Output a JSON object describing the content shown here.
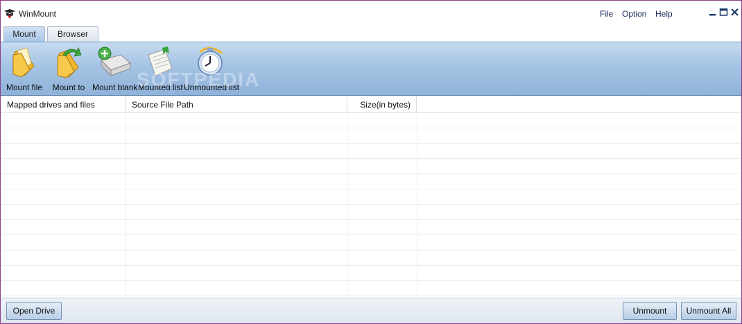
{
  "app": {
    "title": "WinMount"
  },
  "menu": {
    "file": "File",
    "option": "Option",
    "help": "Help"
  },
  "window_controls": {
    "minimize": "minimize-icon",
    "maximize": "maximize-icon",
    "close": "close-icon"
  },
  "tabs": [
    {
      "label": "Mount",
      "active": true
    },
    {
      "label": "Browser",
      "active": false
    }
  ],
  "toolbar": {
    "items": [
      {
        "label": "Mount file",
        "icon": "folder-icon"
      },
      {
        "label": "Mount to",
        "icon": "folder-arrow-icon"
      },
      {
        "label": "Mount blank",
        "icon": "drive-add-icon"
      },
      {
        "label": "Mounted list",
        "icon": "document-list-icon"
      },
      {
        "label": "Unmounted list",
        "icon": "clock-icon"
      }
    ],
    "watermark": "SOFTPEDIA"
  },
  "table": {
    "columns": [
      "Mapped drives and files",
      "Source File Path",
      "Size(in bytes)"
    ],
    "rows": []
  },
  "buttons": {
    "open_drive": "Open Drive",
    "unmount": "Unmount",
    "unmount_all": "Unmount All"
  },
  "colors": {
    "toolbar_top": "#c6dbf0",
    "toolbar_bottom": "#8fb2d8",
    "window_border": "#8a3f8a"
  }
}
